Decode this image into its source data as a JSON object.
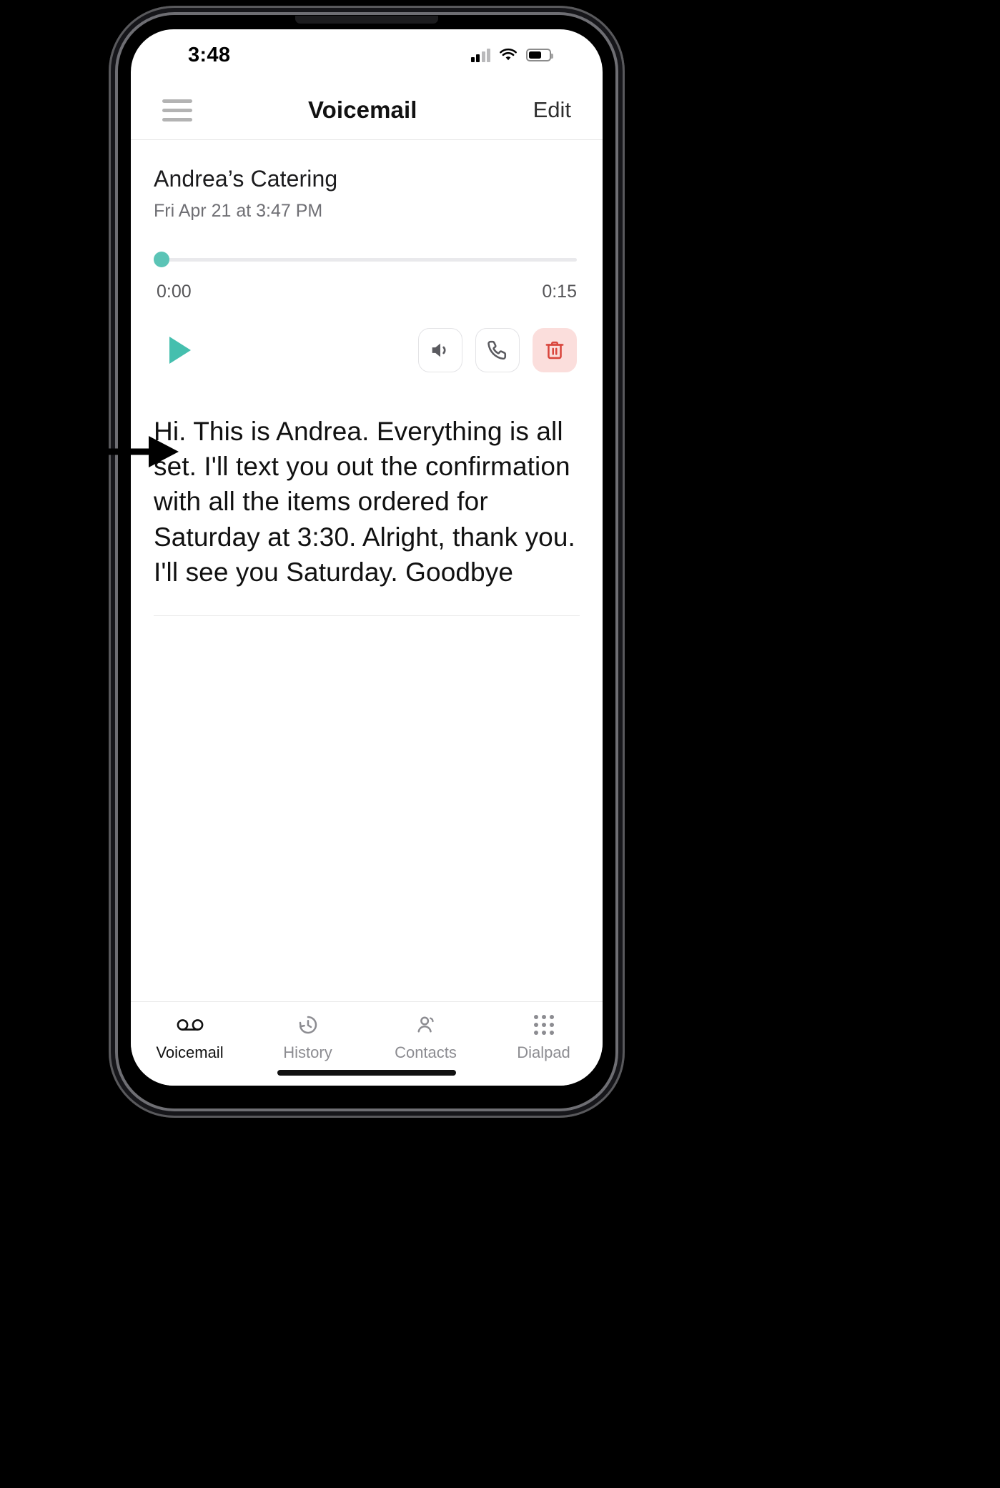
{
  "status_bar": {
    "time": "3:48",
    "signal_icon": "cellular-signal-icon",
    "wifi_icon": "wifi-icon",
    "battery_icon": "battery-icon"
  },
  "nav_bar": {
    "menu_icon": "hamburger-menu-icon",
    "title": "Voicemail",
    "edit_label": "Edit"
  },
  "voicemail": {
    "caller_name": "Andrea’s Catering",
    "timestamp": "Fri Apr 21 at 3:47 PM",
    "progress_current": "0:00",
    "progress_total": "0:15",
    "progress_percent": 0,
    "play_icon": "play-icon",
    "actions": [
      {
        "name": "speaker-button",
        "icon": "speaker-icon",
        "style": "outline"
      },
      {
        "name": "call-back-button",
        "icon": "phone-icon",
        "style": "outline"
      },
      {
        "name": "delete-button",
        "icon": "trash-icon",
        "style": "danger"
      }
    ],
    "transcript": "Hi. This is Andrea. Everything is all set. I'll text you out the confirmation with all the items ordered for Saturday at 3:30.  Alright, thank you. I'll see you Saturday. Goodbye"
  },
  "tab_bar": {
    "tabs": [
      {
        "label": "Voicemail",
        "icon": "voicemail-icon",
        "active": true
      },
      {
        "label": "History",
        "icon": "clock-history-icon",
        "active": false
      },
      {
        "label": "Contacts",
        "icon": "contacts-icon",
        "active": false
      },
      {
        "label": "Dialpad",
        "icon": "dialpad-icon",
        "active": false
      }
    ]
  },
  "annotations": [
    {
      "name": "arrow-pointing-to-play-button",
      "direction": "right"
    },
    {
      "name": "arrow-pointing-to-delete-button",
      "direction": "left"
    }
  ],
  "colors": {
    "accent_teal": "#45bfae",
    "danger_red": "#d9453c",
    "danger_bg": "#fbdedc",
    "muted_gray": "#8c8c91"
  }
}
